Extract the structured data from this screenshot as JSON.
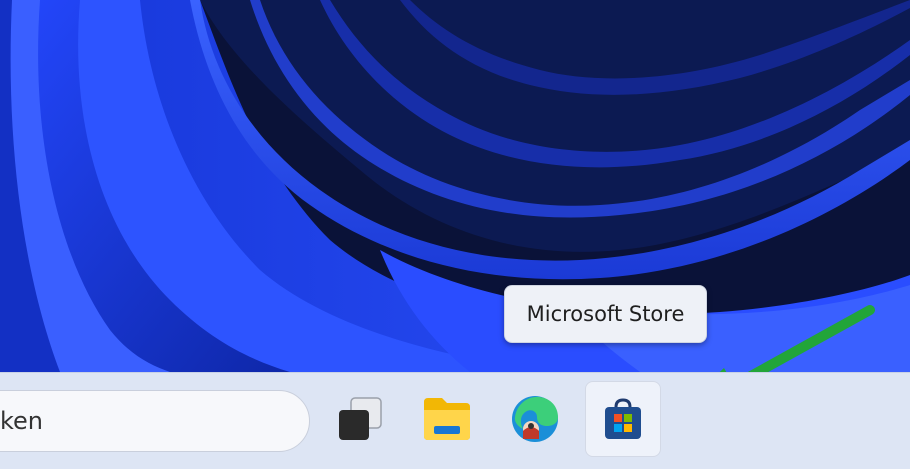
{
  "tooltip": {
    "text": "Microsoft Store"
  },
  "taskbar": {
    "search_text": "ken",
    "apps": [
      {
        "name": "task-view",
        "icon": "task-view-icon"
      },
      {
        "name": "file-explorer",
        "icon": "folder-icon"
      },
      {
        "name": "edge",
        "icon": "edge-icon"
      },
      {
        "name": "microsoft-store",
        "icon": "store-bag-icon",
        "active": true
      }
    ]
  },
  "colors": {
    "wallpaper_dark": "#0b1540",
    "wallpaper_blue": "#1f3fe0",
    "taskbar": "#dde5f4",
    "arrow": "#22a539"
  }
}
